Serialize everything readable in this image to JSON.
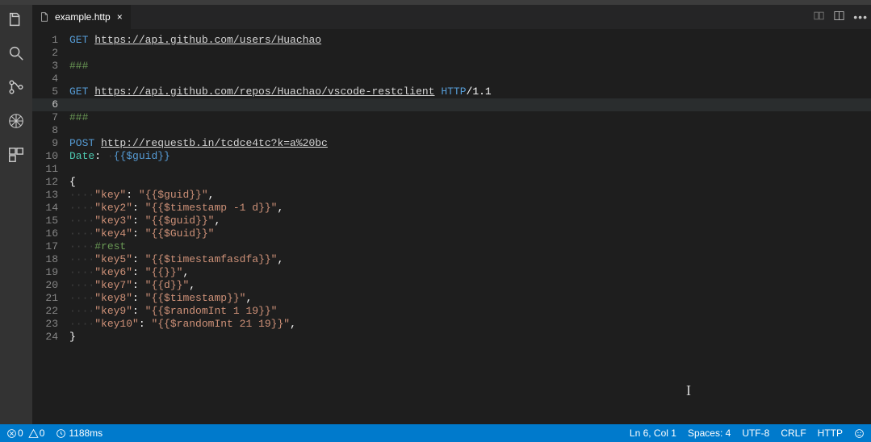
{
  "tabs": {
    "active": {
      "label": "example.http"
    }
  },
  "editor": {
    "highlight_line": 6,
    "lines": [
      {
        "n": 1,
        "segs": [
          {
            "c": "tok-method",
            "t": "GET "
          },
          {
            "c": "tok-url",
            "t": "https://api.github.com/users/Huachao"
          }
        ]
      },
      {
        "n": 2,
        "segs": []
      },
      {
        "n": 3,
        "segs": [
          {
            "c": "tok-delim",
            "t": "###"
          }
        ]
      },
      {
        "n": 4,
        "segs": []
      },
      {
        "n": 5,
        "segs": [
          {
            "c": "tok-method",
            "t": "GET "
          },
          {
            "c": "tok-url",
            "t": "https://api.github.com/repos/Huachao/vscode-restclient"
          },
          {
            "c": "tok-plain",
            "t": " "
          },
          {
            "c": "tok-httpkw",
            "t": "HTTP"
          },
          {
            "c": "tok-ver",
            "t": "/1.1"
          }
        ]
      },
      {
        "n": 6,
        "segs": []
      },
      {
        "n": 7,
        "segs": [
          {
            "c": "tok-delim",
            "t": "###"
          }
        ]
      },
      {
        "n": 8,
        "segs": []
      },
      {
        "n": 9,
        "segs": [
          {
            "c": "tok-method",
            "t": "POST "
          },
          {
            "c": "tok-url",
            "t": "http://requestb.in/tcdce4tc?k=a%20bc"
          }
        ]
      },
      {
        "n": 10,
        "segs": [
          {
            "c": "tok-hdrname",
            "t": "Date"
          },
          {
            "c": "tok-hdrcolon",
            "t": ": "
          },
          {
            "c": "tok-dots",
            "t": "·"
          },
          {
            "c": "tok-var",
            "t": "{{$guid}}"
          }
        ]
      },
      {
        "n": 11,
        "segs": []
      },
      {
        "n": 12,
        "segs": [
          {
            "c": "tok-punc",
            "t": "{"
          }
        ]
      },
      {
        "n": 13,
        "segs": [
          {
            "c": "tok-dots",
            "t": "····"
          },
          {
            "c": "tok-str",
            "t": "\"key\""
          },
          {
            "c": "tok-punc",
            "t": ": "
          },
          {
            "c": "tok-str",
            "t": "\"{{$guid}}\""
          },
          {
            "c": "tok-punc",
            "t": ","
          }
        ]
      },
      {
        "n": 14,
        "segs": [
          {
            "c": "tok-dots",
            "t": "····"
          },
          {
            "c": "tok-str",
            "t": "\"key2\""
          },
          {
            "c": "tok-punc",
            "t": ": "
          },
          {
            "c": "tok-str",
            "t": "\"{{$timestamp -1 d}}\""
          },
          {
            "c": "tok-punc",
            "t": ","
          }
        ]
      },
      {
        "n": 15,
        "segs": [
          {
            "c": "tok-dots",
            "t": "····"
          },
          {
            "c": "tok-str",
            "t": "\"key3\""
          },
          {
            "c": "tok-punc",
            "t": ": "
          },
          {
            "c": "tok-str",
            "t": "\"{{$guid}}\""
          },
          {
            "c": "tok-punc",
            "t": ","
          }
        ]
      },
      {
        "n": 16,
        "segs": [
          {
            "c": "tok-dots",
            "t": "····"
          },
          {
            "c": "tok-str",
            "t": "\"key4\""
          },
          {
            "c": "tok-punc",
            "t": ": "
          },
          {
            "c": "tok-str",
            "t": "\"{{$Guid}}\""
          }
        ]
      },
      {
        "n": 17,
        "segs": [
          {
            "c": "tok-dots",
            "t": "····"
          },
          {
            "c": "tok-legend",
            "t": "#rest"
          }
        ]
      },
      {
        "n": 18,
        "segs": [
          {
            "c": "tok-dots",
            "t": "····"
          },
          {
            "c": "tok-str",
            "t": "\"key5\""
          },
          {
            "c": "tok-punc",
            "t": ": "
          },
          {
            "c": "tok-str",
            "t": "\"{{$timestamfasdfa}}\""
          },
          {
            "c": "tok-punc",
            "t": ","
          }
        ]
      },
      {
        "n": 19,
        "segs": [
          {
            "c": "tok-dots",
            "t": "····"
          },
          {
            "c": "tok-str",
            "t": "\"key6\""
          },
          {
            "c": "tok-punc",
            "t": ": "
          },
          {
            "c": "tok-str",
            "t": "\"{{}}\""
          },
          {
            "c": "tok-punc",
            "t": ","
          }
        ]
      },
      {
        "n": 20,
        "segs": [
          {
            "c": "tok-dots",
            "t": "····"
          },
          {
            "c": "tok-str",
            "t": "\"key7\""
          },
          {
            "c": "tok-punc",
            "t": ": "
          },
          {
            "c": "tok-str",
            "t": "\"{{d}}\""
          },
          {
            "c": "tok-punc",
            "t": ","
          }
        ]
      },
      {
        "n": 21,
        "segs": [
          {
            "c": "tok-dots",
            "t": "····"
          },
          {
            "c": "tok-str",
            "t": "\"key8\""
          },
          {
            "c": "tok-punc",
            "t": ": "
          },
          {
            "c": "tok-str",
            "t": "\"{{$timestamp}}\""
          },
          {
            "c": "tok-punc",
            "t": ","
          }
        ]
      },
      {
        "n": 22,
        "segs": [
          {
            "c": "tok-dots",
            "t": "····"
          },
          {
            "c": "tok-str",
            "t": "\"key9\""
          },
          {
            "c": "tok-punc",
            "t": ": "
          },
          {
            "c": "tok-str",
            "t": "\"{{$randomInt 1 19}}\""
          }
        ]
      },
      {
        "n": 23,
        "segs": [
          {
            "c": "tok-dots",
            "t": "····"
          },
          {
            "c": "tok-str",
            "t": "\"key10\""
          },
          {
            "c": "tok-punc",
            "t": ": "
          },
          {
            "c": "tok-str",
            "t": "\"{{$randomInt 21 19}}\""
          },
          {
            "c": "tok-punc",
            "t": ","
          }
        ]
      },
      {
        "n": 24,
        "segs": [
          {
            "c": "tok-punc",
            "t": "}"
          }
        ]
      }
    ]
  },
  "status": {
    "errors": "0",
    "warnings": "0",
    "duration": "1188ms",
    "position": "Ln 6, Col 1",
    "spaces": "Spaces: 4",
    "encoding": "UTF-8",
    "eol": "CRLF",
    "language": "HTTP"
  }
}
